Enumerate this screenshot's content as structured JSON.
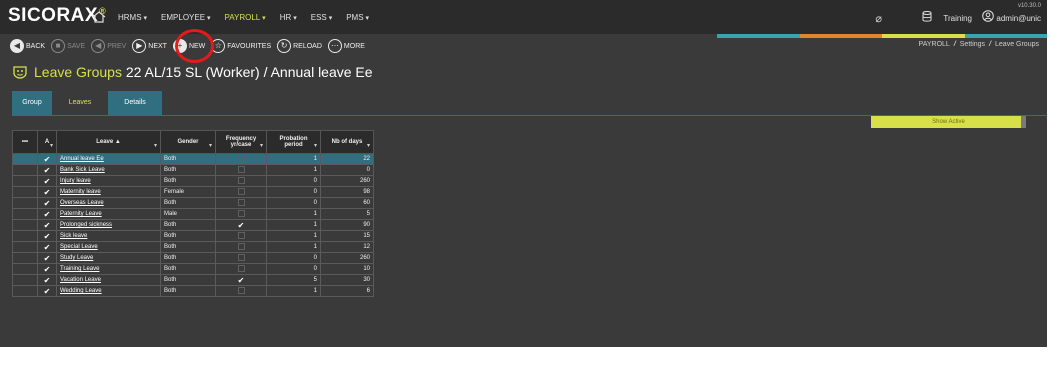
{
  "app": {
    "logo": "SICORAX",
    "logo_mark": "®",
    "version": "v10.30.0"
  },
  "menu": [
    {
      "label": "HRMS",
      "active": false
    },
    {
      "label": "EMPLOYEE",
      "active": false
    },
    {
      "label": "PAYROLL",
      "active": true
    },
    {
      "label": "HR",
      "active": false
    },
    {
      "label": "ESS",
      "active": false
    },
    {
      "label": "PMS",
      "active": false
    }
  ],
  "topright": {
    "database": "Training",
    "user": "admin@unic"
  },
  "toolbar": {
    "back": "BACK",
    "save": "SAVE",
    "prev": "PREV",
    "next": "NEXT",
    "new": "NEW",
    "favourites": "FAVOURITES",
    "reload": "RELOAD",
    "more": "MORE"
  },
  "breadcrumb": [
    "PAYROLL",
    "Settings",
    "Leave Groups"
  ],
  "page": {
    "title_prefix": "Leave Groups",
    "title_rest": "22 AL/15 SL (Worker) /  Annual leave Ee"
  },
  "tabs": [
    {
      "label": "Group",
      "active": false
    },
    {
      "label": "Leaves",
      "active": true
    },
    {
      "label": "Details",
      "active": false
    }
  ],
  "show_active": "Show Active",
  "colors": {
    "accent_yellow": "#d7e04a",
    "teal": "#2f6f80",
    "strip": [
      "#3aa3b0",
      "#e0862a",
      "#d7e04a",
      "#3aa3b0"
    ]
  },
  "columns": {
    "menu": "•••",
    "active": "A",
    "leave": "Leave ▲",
    "gender": "Gender",
    "frequency": "Frequency yr/case",
    "probation": "Probation period",
    "days": "Nb of days"
  },
  "rows": [
    {
      "leave": "Annual leave Ee",
      "gender": "Both",
      "freq": false,
      "probation": "1",
      "days": "22"
    },
    {
      "leave": "Bank Sick Leave",
      "gender": "Both",
      "freq": false,
      "probation": "1",
      "days": "0"
    },
    {
      "leave": "Injury leave",
      "gender": "Both",
      "freq": false,
      "probation": "0",
      "days": "260"
    },
    {
      "leave": "Maternity leave",
      "gender": "Female",
      "freq": false,
      "probation": "0",
      "days": "98"
    },
    {
      "leave": "Overseas Leave",
      "gender": "Both",
      "freq": false,
      "probation": "0",
      "days": "60"
    },
    {
      "leave": "Paternity Leave",
      "gender": "Male",
      "freq": false,
      "probation": "1",
      "days": "5"
    },
    {
      "leave": "Prolonged sickness",
      "gender": "Both",
      "freq": true,
      "probation": "1",
      "days": "90"
    },
    {
      "leave": "Sick leave",
      "gender": "Both",
      "freq": false,
      "probation": "1",
      "days": "15"
    },
    {
      "leave": "Special Leave",
      "gender": "Both",
      "freq": false,
      "probation": "1",
      "days": "12"
    },
    {
      "leave": "Study Leave",
      "gender": "Both",
      "freq": false,
      "probation": "0",
      "days": "260"
    },
    {
      "leave": "Training Leave",
      "gender": "Both",
      "freq": false,
      "probation": "0",
      "days": "10"
    },
    {
      "leave": "Vacation Leave",
      "gender": "Both",
      "freq": true,
      "probation": "5",
      "days": "30"
    },
    {
      "leave": "Wedding Leave",
      "gender": "Both",
      "freq": false,
      "probation": "1",
      "days": "6"
    }
  ]
}
